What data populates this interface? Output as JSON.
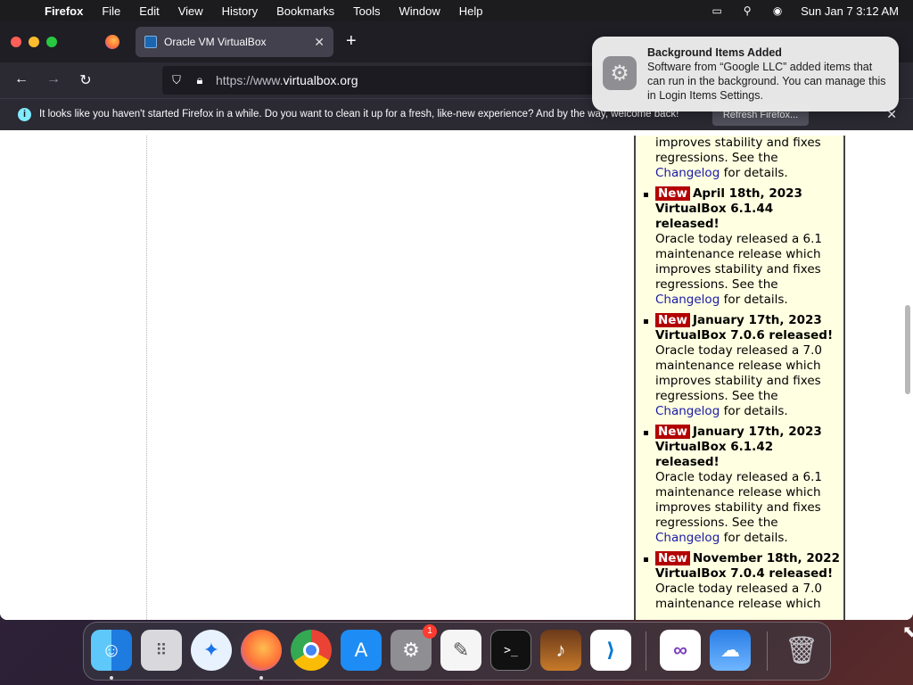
{
  "menubar": {
    "items": [
      "Firefox",
      "File",
      "Edit",
      "View",
      "History",
      "Bookmarks",
      "Tools",
      "Window",
      "Help"
    ],
    "clock": "Sun Jan 7  3:12 AM"
  },
  "browser": {
    "tab_title": "Oracle VM VirtualBox",
    "url_prefix": "https://www.",
    "url_domain": "virtualbox.org",
    "infobar_message": "It looks like you haven't started Firefox in a while. Do you want to clean it up for a fresh, like-new experience? And by the way, welcome back!",
    "infobar_button": "Refresh Firefox..."
  },
  "notification": {
    "title": "Background Items Added",
    "body": "Software from “Google LLC” added items that can run in the background. You can manage this in Login Items Settings."
  },
  "news": {
    "badge": "New",
    "partial_top": {
      "body": "improves stability and fixes regressions. See the",
      "link": "Changelog",
      "tail": "for details."
    },
    "items": [
      {
        "header": "April 18th, 2023 VirtualBox 6.1.44 released!",
        "body": "Oracle today released a 6.1 maintenance release which improves stability and fixes regressions. See the",
        "link": "Changelog",
        "tail": "for details."
      },
      {
        "header": "January 17th, 2023 VirtualBox 7.0.6 released!",
        "body": "Oracle today released a 7.0 maintenance release which improves stability and fixes regressions. See the",
        "link": "Changelog",
        "tail": "for details."
      },
      {
        "header": "January 17th, 2023 VirtualBox 6.1.42 released!",
        "body": "Oracle today released a 6.1 maintenance release which improves stability and fixes regressions. See the",
        "link": "Changelog",
        "tail": "for details."
      },
      {
        "header": "November 18th, 2022 VirtualBox 7.0.4 released!",
        "body": "Oracle today released a 7.0 maintenance release which",
        "link": "",
        "tail": ""
      }
    ]
  },
  "dock": {
    "settings_badge": "1"
  }
}
